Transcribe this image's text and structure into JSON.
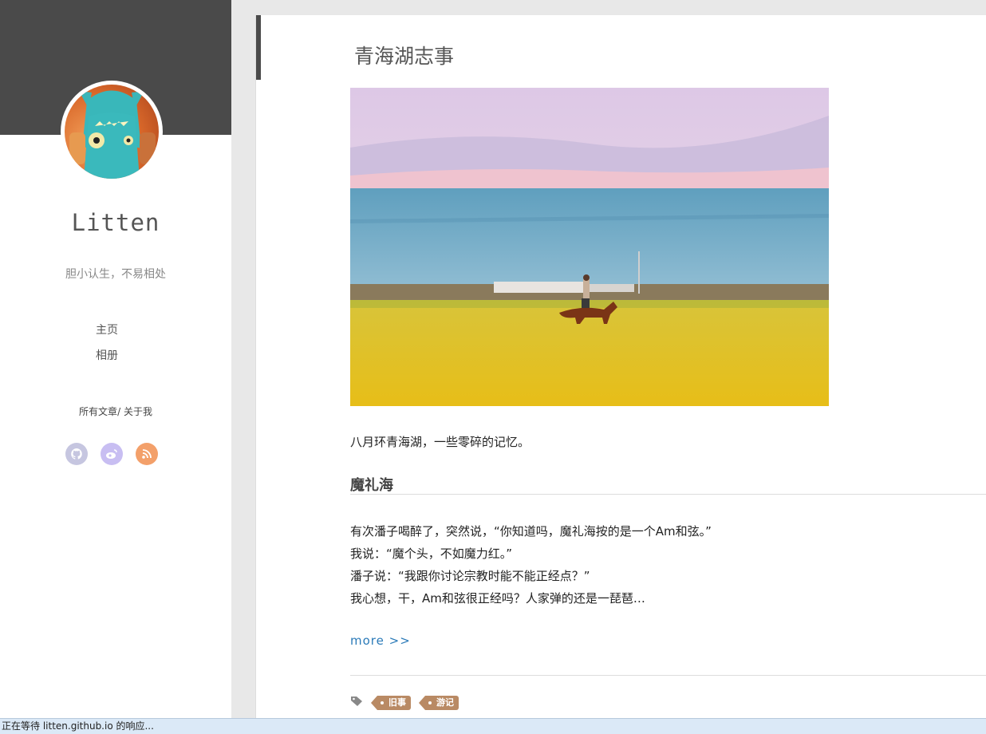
{
  "sidebar": {
    "site_title": "Litten",
    "subtitle": "胆小认生，不易相处",
    "nav": [
      {
        "label": "主页"
      },
      {
        "label": "相册"
      }
    ],
    "links": {
      "all_posts": "所有文章",
      "separator": "/",
      "about": "关于我"
    },
    "social": [
      {
        "icon": "github-icon",
        "color": "#c6c6e0"
      },
      {
        "icon": "weibo-icon",
        "color": "#c8bef2"
      },
      {
        "icon": "rss-icon",
        "color": "#f3a06a"
      }
    ]
  },
  "post": {
    "title": "青海湖志事",
    "intro": "八月环青海湖，一些零碎的记忆。",
    "section_heading": "魔礼海",
    "lines": [
      "有次潘子喝醉了，突然说，“你知道吗，魔礼海按的是一个Am和弦。”",
      "我说：“魔个头，不如魔力红。”",
      "潘子说：“我跟你讨论宗教时能不能正经点？”",
      "我心想，干，Am和弦很正经吗？人家弹的还是一琵琶…"
    ],
    "more_label": "more >>",
    "tags": [
      "旧事",
      "游记"
    ]
  },
  "statusbar": {
    "text": "正在等待 litten.github.io 的响应..."
  }
}
